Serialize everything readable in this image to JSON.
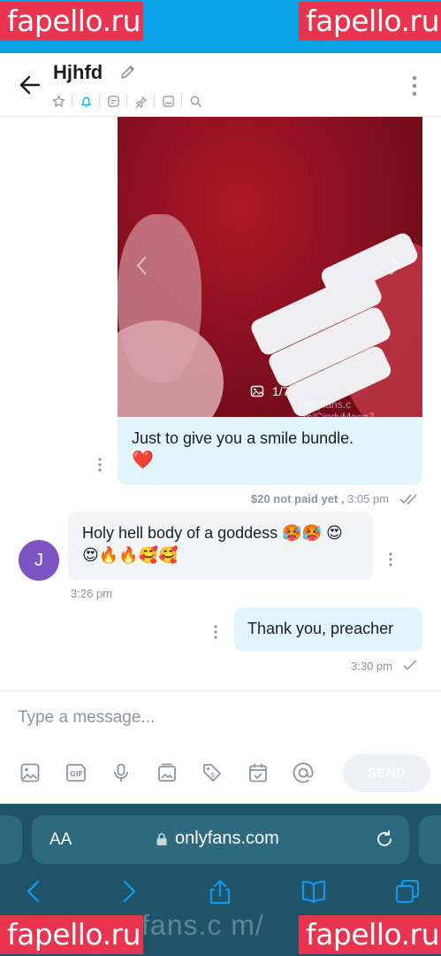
{
  "watermarks": {
    "top_left": "fapello.ru",
    "top_right": "fapello.ru",
    "bottom_left": "fapello.ru",
    "bottom_right": "fapello.ru",
    "bottom_center": "fans.c m/"
  },
  "header": {
    "title": "Hjhfd"
  },
  "media": {
    "counter": "1/7",
    "watermark": "onlyfans.c m/CindyMoon7"
  },
  "messages": [
    {
      "text": "Just to give you a smile bundle.",
      "emoji": "❤️",
      "price_note": "$20 not paid yet ,",
      "time": "3:05 pm"
    },
    {
      "avatar": "J",
      "text": "Holy hell body of a goddess 🥵🥵 😍😍🔥🔥🥰🥰",
      "time": "3:26 pm"
    },
    {
      "text": "Thank you, preacher",
      "time": "3:30 pm"
    }
  ],
  "composer": {
    "placeholder": "Type a message...",
    "send_label": "SEND"
  },
  "browser": {
    "aa_label": "AA",
    "domain": "onlyfans.com"
  },
  "colors": {
    "status_bar": "#0aa3e8",
    "watermark": "#e8344f",
    "accent": "#00aff0",
    "outgoing_bubble": "#e3f5fc",
    "incoming_bubble": "#f2f4f6",
    "avatar": "#7c53c3",
    "browser_bar": "#1f5367"
  }
}
